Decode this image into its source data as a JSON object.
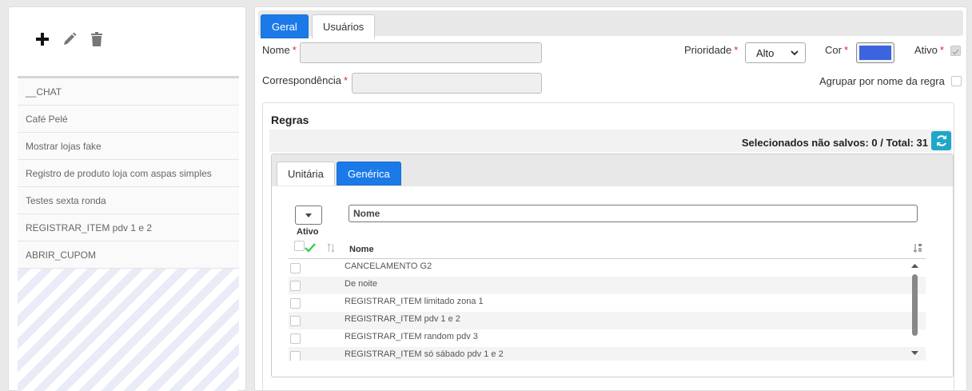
{
  "left": {
    "toolbar": {
      "add": "add-icon",
      "edit": "pencil-icon",
      "delete": "trash-icon"
    },
    "items": [
      {
        "label": "__CHAT"
      },
      {
        "label": "Café Pelé"
      },
      {
        "label": "Mostrar lojas fake"
      },
      {
        "label": "Registro de produto loja com aspas simples"
      },
      {
        "label": "Testes sexta ronda"
      },
      {
        "label": "REGISTRAR_ITEM pdv 1 e 2"
      },
      {
        "label": "ABRIR_CUPOM"
      }
    ]
  },
  "tabs": {
    "geral": "Geral",
    "usuarios": "Usuários"
  },
  "form": {
    "nome_label": "Nome",
    "prioridade_label": "Prioridade",
    "prioridade_value": "Alto",
    "cor_label": "Cor",
    "cor_value": "#3c64e0",
    "ativo_label": "Ativo",
    "correspondencia_label": "Correspondência",
    "agrupar_label": "Agrupar por nome da regra",
    "required_mark": "*"
  },
  "regras": {
    "title": "Regras",
    "status": "Selecionados não salvos: 0 /  Total: 31",
    "tabs": {
      "unitaria": "Unitária",
      "generica": "Genérica"
    },
    "filter_placeholder": "Nome",
    "ativo_header": "Ativo",
    "nome_header": "Nome",
    "rows": [
      {
        "name": "CANCELAMENTO G2"
      },
      {
        "name": "De noite"
      },
      {
        "name": "REGISTRAR_ITEM limitado zona 1"
      },
      {
        "name": "REGISTRAR_ITEM pdv 1 e 2"
      },
      {
        "name": "REGISTRAR_ITEM random pdv 3"
      },
      {
        "name": "REGISTRAR_ITEM só sábado pdv 1 e 2"
      }
    ]
  },
  "colors": {
    "accent": "#1b7ae8",
    "refresh": "#1fa7c9",
    "required": "#e0262d",
    "check": "#2ecc40"
  }
}
